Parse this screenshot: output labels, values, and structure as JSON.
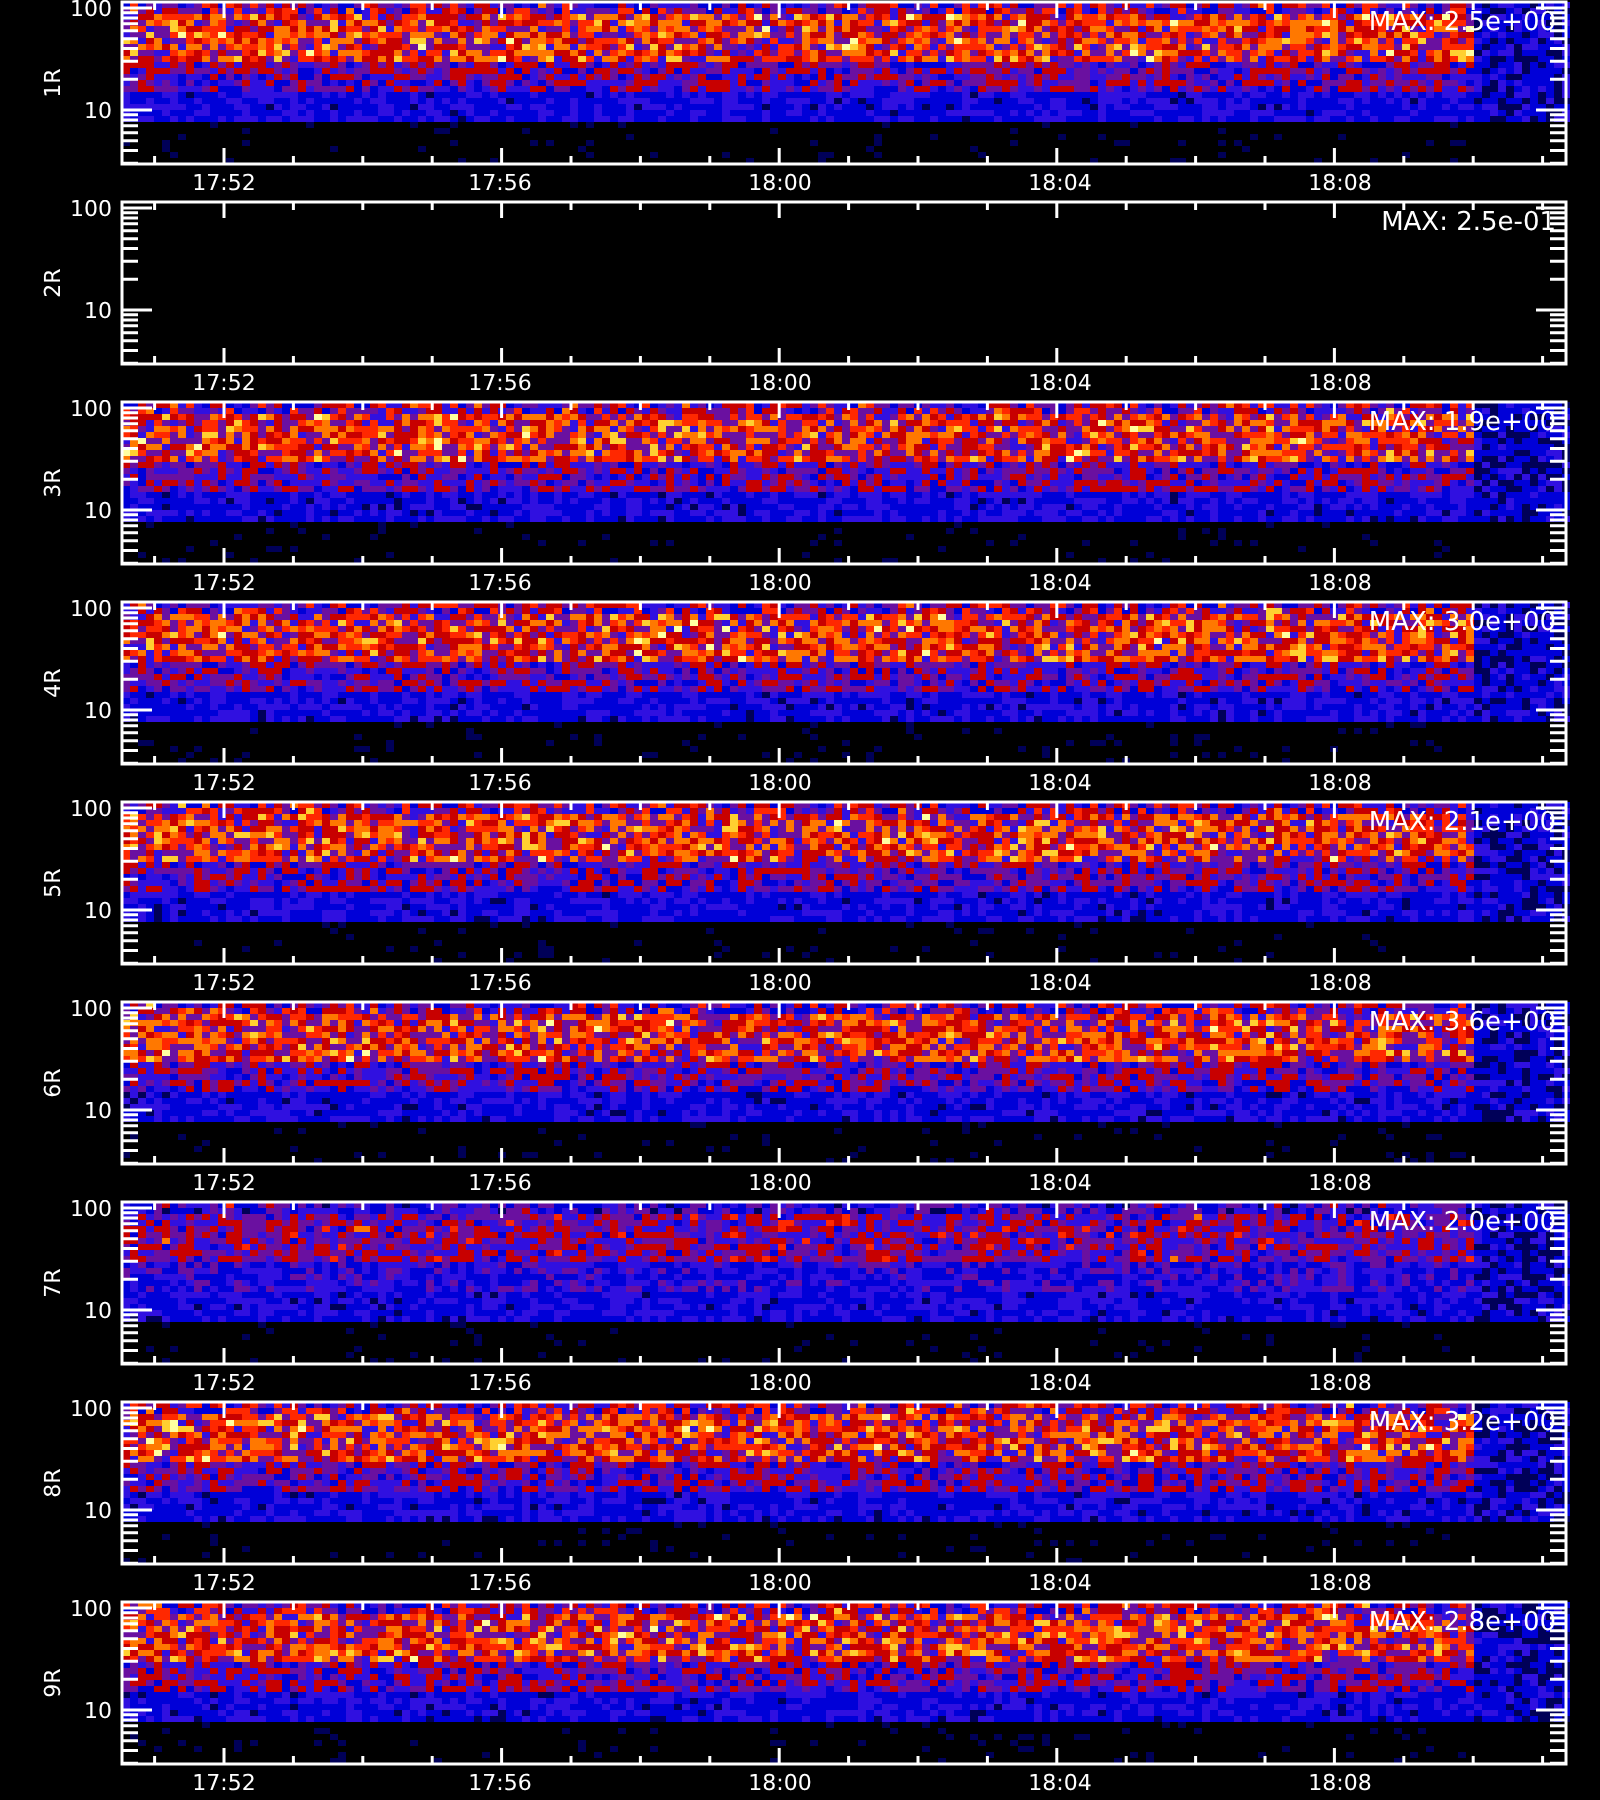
{
  "panels": [
    {
      "label": "1R",
      "max": "MAX: 2.5e+00",
      "has_signal": true,
      "y_ticks": [
        "100",
        "10"
      ],
      "x_ticks": [
        "17:52",
        "17:56",
        "18:00",
        "18:04",
        "18:08"
      ]
    },
    {
      "label": "2R",
      "max": "MAX: 2.5e-01",
      "has_signal": false,
      "y_ticks": [
        "100",
        "10"
      ],
      "x_ticks": [
        "17:52",
        "17:56",
        "18:00",
        "18:04",
        "18:08"
      ]
    },
    {
      "label": "3R",
      "max": "MAX: 1.9e+00",
      "has_signal": true,
      "y_ticks": [
        "100",
        "10"
      ],
      "x_ticks": [
        "17:52",
        "17:56",
        "18:00",
        "18:04",
        "18:08"
      ]
    },
    {
      "label": "4R",
      "max": "MAX: 3.0e+00",
      "has_signal": true,
      "y_ticks": [
        "100",
        "10"
      ],
      "x_ticks": [
        "17:52",
        "17:56",
        "18:00",
        "18:04",
        "18:08"
      ]
    },
    {
      "label": "5R",
      "max": "MAX: 2.1e+00",
      "has_signal": true,
      "y_ticks": [
        "100",
        "10"
      ],
      "x_ticks": [
        "17:52",
        "17:56",
        "18:00",
        "18:04",
        "18:08"
      ]
    },
    {
      "label": "6R",
      "max": "MAX: 3.6e+00",
      "has_signal": true,
      "y_ticks": [
        "100",
        "10"
      ],
      "x_ticks": [
        "17:52",
        "17:56",
        "18:00",
        "18:04",
        "18:08"
      ]
    },
    {
      "label": "7R",
      "max": "MAX: 2.0e+00",
      "has_signal": true,
      "y_ticks": [
        "100",
        "10"
      ],
      "x_ticks": [
        "17:52",
        "17:56",
        "18:00",
        "18:04",
        "18:08"
      ]
    },
    {
      "label": "8R",
      "max": "MAX: 3.2e+00",
      "has_signal": true,
      "y_ticks": [
        "100",
        "10"
      ],
      "x_ticks": [
        "17:52",
        "17:56",
        "18:00",
        "18:04",
        "18:08"
      ]
    },
    {
      "label": "9R",
      "max": "MAX: 2.8e+00",
      "has_signal": true,
      "y_ticks": [
        "100",
        "10"
      ],
      "x_ticks": [
        "17:52",
        "17:56",
        "18:00",
        "18:04",
        "18:08"
      ]
    }
  ]
}
